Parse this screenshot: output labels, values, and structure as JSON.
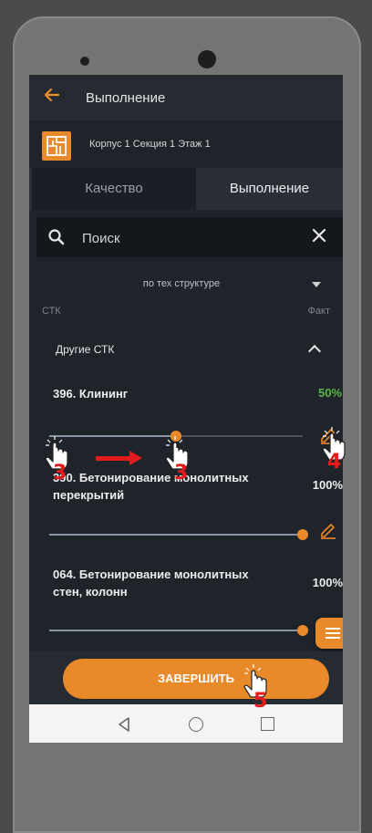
{
  "appbar": {
    "back_icon": "arrow-left-icon",
    "title": "Выполнение"
  },
  "location": {
    "icon": "building-logo-icon",
    "text": "Корпус 1 Секция 1 Этаж 1"
  },
  "tabs": [
    {
      "label": "Качество",
      "active": false
    },
    {
      "label": "Выполнение",
      "active": true
    }
  ],
  "search": {
    "icon": "search-icon",
    "placeholder": "Поиск",
    "value": "",
    "clear_icon": "close-icon"
  },
  "structure_filter": {
    "selected": "по тех структуре"
  },
  "columns": {
    "left": "СТК",
    "right": "Факт"
  },
  "group": {
    "label": "Другие СТК",
    "expanded": true
  },
  "items": [
    {
      "name": "396. Клининг",
      "value_label": "50%",
      "value": 0.5,
      "value_color": "#57b848"
    },
    {
      "name": "390. Бетонирование монолитных перекрытий",
      "value_label": "100%",
      "value": 1.0,
      "value_color": "#ececec"
    },
    {
      "name": "064. Бетонирование монолитных стен, колонн",
      "value_label": "100%",
      "value": 1.0,
      "value_color": "#ececec"
    }
  ],
  "fab": {
    "icon": "menu-icon"
  },
  "finish_button": {
    "label": "ЗАВЕРШИТЬ"
  },
  "navbar": {
    "back": "nav-back-icon",
    "home": "nav-home-icon",
    "recents": "nav-recents-icon"
  },
  "annotations": {
    "step_a": "3",
    "step_b": "3",
    "step_c": "4",
    "step_d": "5"
  },
  "colors": {
    "accent": "#e8892a",
    "background": "#1f232a",
    "success": "#57b848",
    "annotation": "#e21b1b"
  }
}
